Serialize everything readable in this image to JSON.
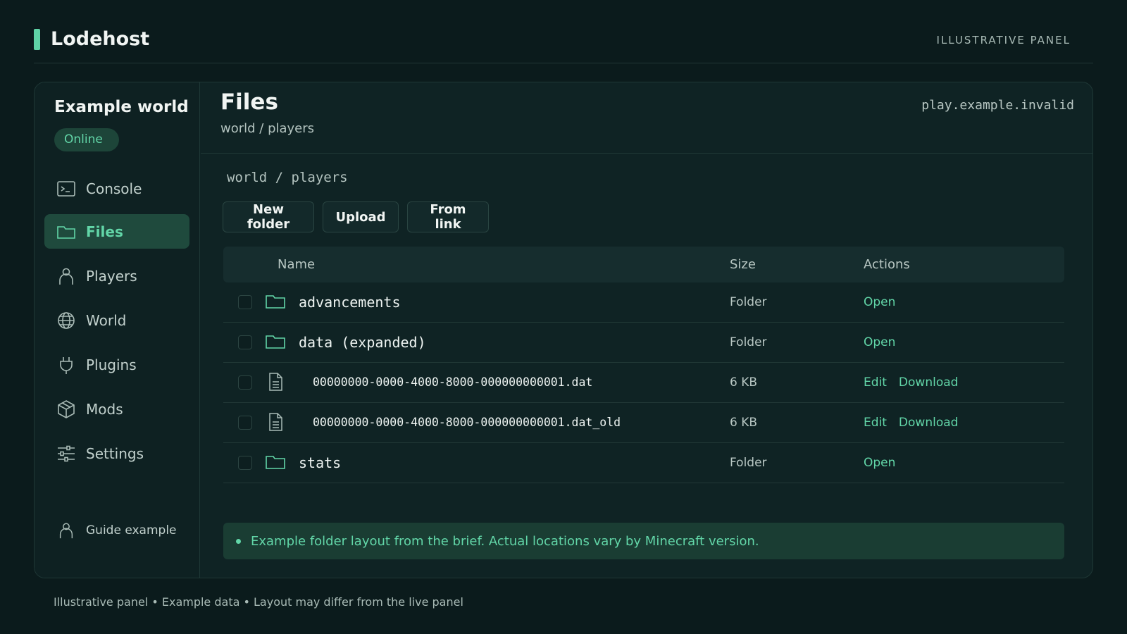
{
  "app": {
    "brand": "Lodehost",
    "top_note": "ILLUSTRATIVE PANEL"
  },
  "colors": {
    "accent": "#62d6a8",
    "background": "#0b1b1c",
    "panel": "#0f2324",
    "active_nav": "#1f4a3d"
  },
  "sidebar": {
    "server_name": "Example world",
    "status": "Online",
    "items": [
      {
        "label": "Console",
        "icon": "console-icon"
      },
      {
        "label": "Files",
        "icon": "folder-icon",
        "active": true
      },
      {
        "label": "Players",
        "icon": "user-icon"
      },
      {
        "label": "World",
        "icon": "globe-icon"
      },
      {
        "label": "Plugins",
        "icon": "plug-icon"
      },
      {
        "label": "Mods",
        "icon": "cube-icon"
      },
      {
        "label": "Settings",
        "icon": "sliders-icon"
      }
    ],
    "user": {
      "label": "Guide example",
      "icon": "user-icon"
    }
  },
  "header": {
    "title": "Files",
    "breadcrumb": "world / players",
    "host": "play.example.invalid"
  },
  "path": "world / players",
  "toolbar": {
    "new_folder": "New folder",
    "upload": "Upload",
    "from_link": "From link"
  },
  "table": {
    "columns": {
      "name": "Name",
      "size": "Size",
      "actions": "Actions"
    },
    "rows": [
      {
        "name": "advancements",
        "type": "folder",
        "size": "Folder",
        "actions": [
          "Open"
        ]
      },
      {
        "name": "data (expanded)",
        "type": "folder",
        "size": "Folder",
        "actions": [
          "Open"
        ]
      },
      {
        "name": "00000000-0000-4000-8000-000000000001.dat",
        "type": "file",
        "size": "6 KB",
        "actions": [
          "Edit",
          "Download"
        ]
      },
      {
        "name": "00000000-0000-4000-8000-000000000001.dat_old",
        "type": "file",
        "size": "6 KB",
        "actions": [
          "Edit",
          "Download"
        ]
      },
      {
        "name": "stats",
        "type": "folder",
        "size": "Folder",
        "actions": [
          "Open"
        ]
      }
    ]
  },
  "notice": "Example folder layout from the brief. Actual locations vary by Minecraft version.",
  "footer": "Illustrative panel • Example data • Layout may differ from the live panel"
}
